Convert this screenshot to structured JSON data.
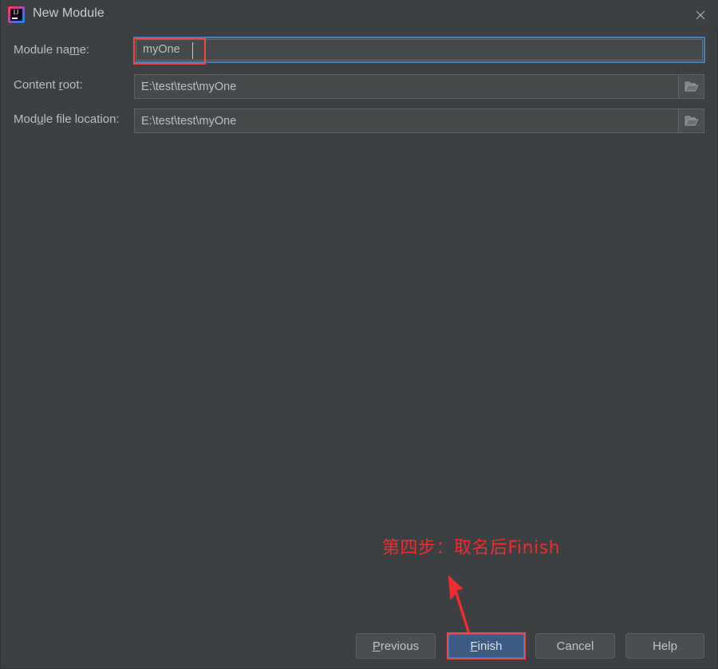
{
  "window": {
    "title": "New Module",
    "app_icon": "intellij-idea-icon",
    "icon_text": "IJ",
    "close_icon": "close-icon"
  },
  "form": {
    "fields": [
      {
        "id": "module-name",
        "label_before": "Module na",
        "label_mnemonic": "m",
        "label_after": "e:",
        "value": "myOne",
        "placeholder": "",
        "focused": true,
        "has_browse": false
      },
      {
        "id": "content-root",
        "label_before": "Content ",
        "label_mnemonic": "r",
        "label_after": "oot:",
        "value": "E:\\test\\test\\myOne",
        "placeholder": "",
        "focused": false,
        "has_browse": true,
        "browse_icon": "folder-open-icon"
      },
      {
        "id": "module-file",
        "label_before": "Mod",
        "label_mnemonic": "u",
        "label_after": "le file location:",
        "value": "E:\\test\\test\\myOne",
        "placeholder": "",
        "focused": false,
        "has_browse": true,
        "browse_icon": "folder-open-icon"
      }
    ]
  },
  "buttons": {
    "previous": {
      "before": "",
      "mnemonic": "P",
      "after": "revious"
    },
    "finish": {
      "before": "",
      "mnemonic": "F",
      "after": "inish",
      "default": true
    },
    "cancel": {
      "before": "Cancel",
      "mnemonic": "",
      "after": ""
    },
    "help": {
      "before": "Help",
      "mnemonic": "",
      "after": ""
    }
  },
  "annotations": {
    "step_text": "第四步：取名后Finish",
    "arrow": "up-left-arrow",
    "highlight_color": "#f24646",
    "text_color": "#f22c2c"
  },
  "colors": {
    "dialog_background": "#3c4043",
    "input_background": "#45494a",
    "default_button": "#3c5a82",
    "focus_border": "#4a7ebb",
    "text": "#b9bec4"
  },
  "bottom_clipped_text": ""
}
